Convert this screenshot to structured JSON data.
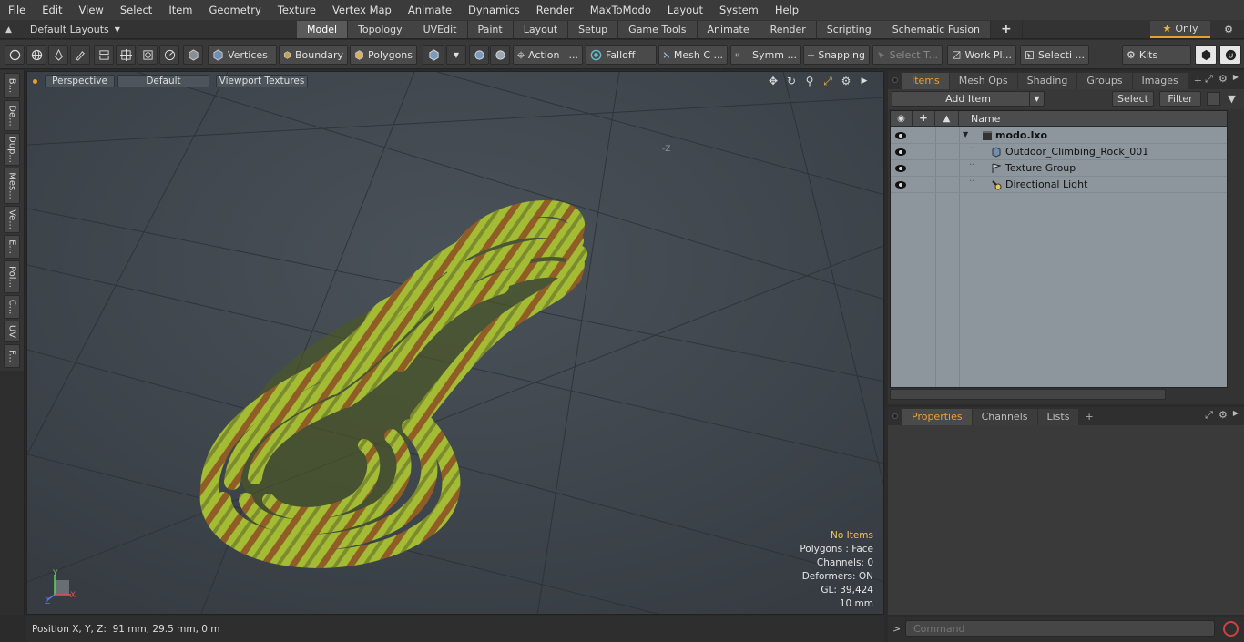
{
  "menu": [
    "File",
    "Edit",
    "View",
    "Select",
    "Item",
    "Geometry",
    "Texture",
    "Vertex Map",
    "Animate",
    "Dynamics",
    "Render",
    "MaxToModo",
    "Layout",
    "System",
    "Help"
  ],
  "layout_selector": "Default Layouts",
  "mode_tabs": [
    {
      "label": "Model",
      "active": true
    },
    {
      "label": "Topology",
      "active": false
    },
    {
      "label": "UVEdit",
      "active": false
    },
    {
      "label": "Paint",
      "active": false
    },
    {
      "label": "Layout",
      "active": false
    },
    {
      "label": "Setup",
      "active": false
    },
    {
      "label": "Game Tools",
      "active": false
    },
    {
      "label": "Animate",
      "active": false
    },
    {
      "label": "Render",
      "active": false
    },
    {
      "label": "Scripting",
      "active": false
    },
    {
      "label": "Schematic Fusion",
      "active": false
    }
  ],
  "only_label": "Only",
  "toolbar": {
    "vertices": "Vertices",
    "boundary": "Boundary",
    "polygons": "Polygons",
    "action": "Action",
    "action_more": "...",
    "falloff": "Falloff",
    "mesh": "Mesh C ...",
    "symm": "Symm ...",
    "snapping": "Snapping",
    "select_t": "Select T...",
    "work_pl": "Work Pl...",
    "selecti": "Selecti ...",
    "kits": "Kits"
  },
  "left_tools": [
    "B...",
    "De...",
    "Dup...",
    "Mes...",
    "Ve...",
    "E...",
    "Pol...",
    "C...",
    "UV",
    "F..."
  ],
  "viewport": {
    "perspective": "Perspective",
    "default": "Default",
    "viewport_textures": "Viewport Textures",
    "neg_z": "-Z",
    "axis_y": "Y",
    "axis_x": "X",
    "axis_z": "Z",
    "info": {
      "no_items": "No Items",
      "polygons": "Polygons : Face",
      "channels": "Channels: 0",
      "deformers": "Deformers: ON",
      "gl": "GL: 39,424",
      "scale": "10 mm"
    }
  },
  "status": "Position X, Y, Z:  91 mm, 29.5 mm, 0 m",
  "items_panel": {
    "tabs": [
      "Items",
      "Mesh Ops",
      "Shading",
      "Groups",
      "Images"
    ],
    "add_item": "Add Item",
    "select": "Select",
    "filter": "Filter",
    "name_header": "Name",
    "rows": [
      {
        "label": "modo.lxo",
        "icon": "scene-icon"
      },
      {
        "label": "Outdoor_Climbing_Rock_001",
        "icon": "mesh-icon"
      },
      {
        "label": "Texture Group",
        "icon": "texture-group-icon"
      },
      {
        "label": "Directional Light",
        "icon": "light-icon"
      }
    ]
  },
  "props_panel": {
    "tabs": [
      "Properties",
      "Channels",
      "Lists"
    ]
  },
  "command": {
    "placeholder": "Command"
  },
  "colors": {
    "accent": "#e8a02a",
    "viewport_bg": "#3e454c",
    "rope_base": "#9cb830",
    "rope_stripe": "#8a3a24"
  }
}
